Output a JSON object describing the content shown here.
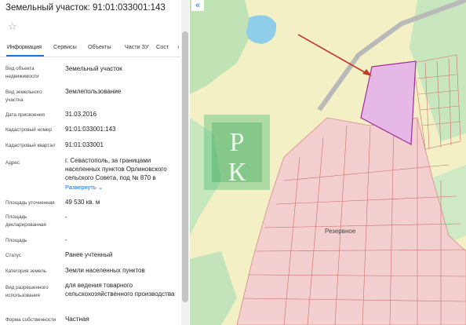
{
  "header": {
    "title": "Земельный участок: 91:01:033001:143"
  },
  "icons": {
    "favorite": "star-icon",
    "collapse": "double-chevron-left-icon",
    "expand": "chevron-down-icon"
  },
  "tabs": [
    {
      "label": "Информация"
    },
    {
      "label": "Сервисы"
    },
    {
      "label": "Объекты"
    },
    {
      "label": "Части ЗУ"
    },
    {
      "label": "Сост"
    }
  ],
  "tabs_overflow": "›",
  "details": [
    {
      "label": "Вид объекта недвижимости",
      "value": "Земельный участок"
    },
    {
      "label": "Вид земельного участка",
      "value": "Землепользование"
    },
    {
      "label": "Дата присвоения",
      "value": "31.03.2016"
    },
    {
      "label": "Кадастровый номер",
      "value": "91:01:033001:143"
    },
    {
      "label": "Кадастровый квартал",
      "value": "91:01:033001"
    },
    {
      "label": "Адрес",
      "value": "г. Севастополь, за границами населенных пунктов Орлиновского сельского Совета, под № 870 в"
    },
    {
      "label": "Площадь уточненная",
      "value": "49 530 кв. м"
    },
    {
      "label": "Площадь декларированная",
      "value": "-"
    },
    {
      "label": "Площадь",
      "value": "-"
    },
    {
      "label": "Статус",
      "value": "Ранее учтенный"
    },
    {
      "label": "Категория земель",
      "value": "Земли населенных пунктов"
    },
    {
      "label": "Вид разрешенного использования",
      "value": "для ведения товарного сельскохозяйственного производства"
    },
    {
      "label": "Форма собственности",
      "value": "Частная"
    }
  ],
  "address_expand": "Развернуть",
  "map": {
    "village_label": "Резервное",
    "watermark_letters": "РК",
    "parcel_color": "#e6b8e6",
    "parcel_border": "#9c2f9c",
    "arrow_color": "#c0392b"
  }
}
